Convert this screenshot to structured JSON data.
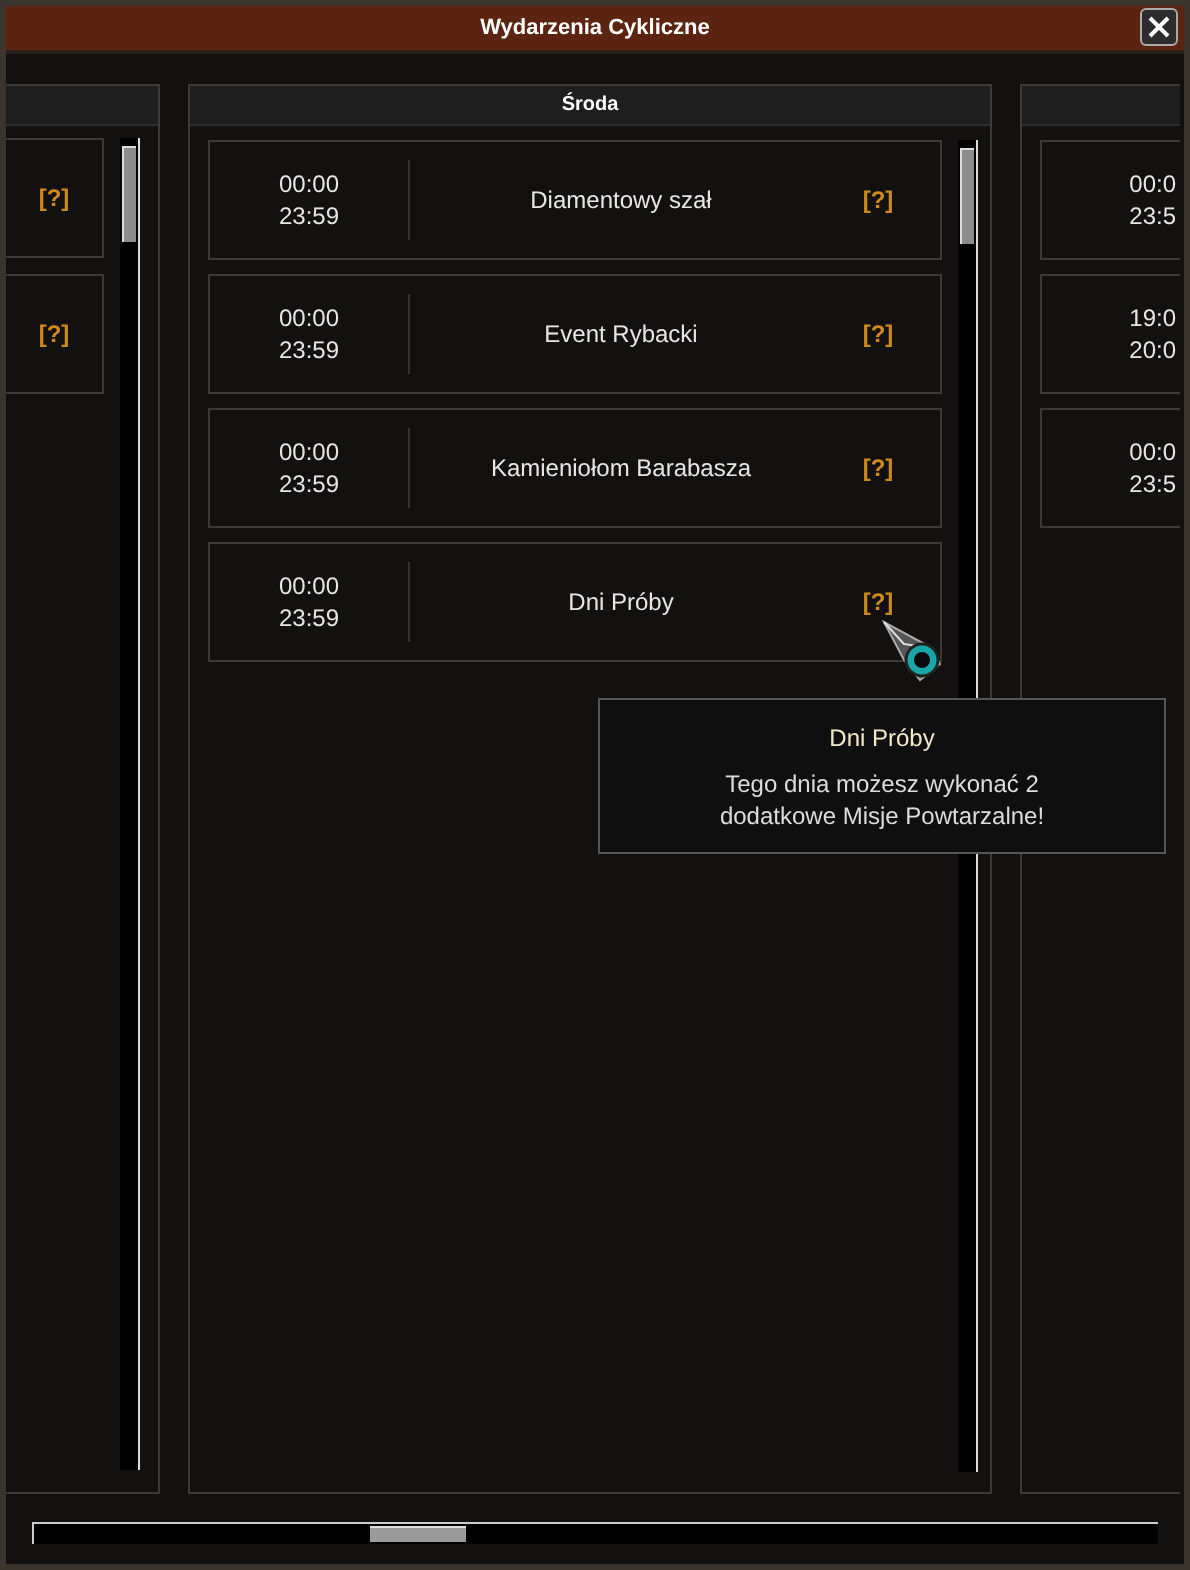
{
  "window": {
    "title": "Wydarzenia Cykliczne"
  },
  "columns": [
    {
      "kind": "left",
      "events": [
        {
          "info": "[?]"
        },
        {
          "info": "[?]"
        }
      ]
    },
    {
      "kind": "full",
      "header": "Środa",
      "events": [
        {
          "start": "00:00",
          "end": "23:59",
          "name": "Diamentowy szał",
          "info": "[?]"
        },
        {
          "start": "00:00",
          "end": "23:59",
          "name": "Event Rybacki",
          "info": "[?]"
        },
        {
          "start": "00:00",
          "end": "23:59",
          "name": "Kamieniołom Barabasza",
          "info": "[?]"
        },
        {
          "start": "00:00",
          "end": "23:59",
          "name": "Dni Próby",
          "info": "[?]"
        }
      ]
    },
    {
      "kind": "right",
      "events": [
        {
          "start": "00:0",
          "end": "23:5"
        },
        {
          "start": "19:0",
          "end": "20:0"
        },
        {
          "start": "00:0",
          "end": "23:5"
        }
      ]
    }
  ],
  "tooltip": {
    "title": "Dni Próby",
    "text": "Tego dnia możesz wykonać 2 dodatkowe Misje Powtarzalne!"
  }
}
